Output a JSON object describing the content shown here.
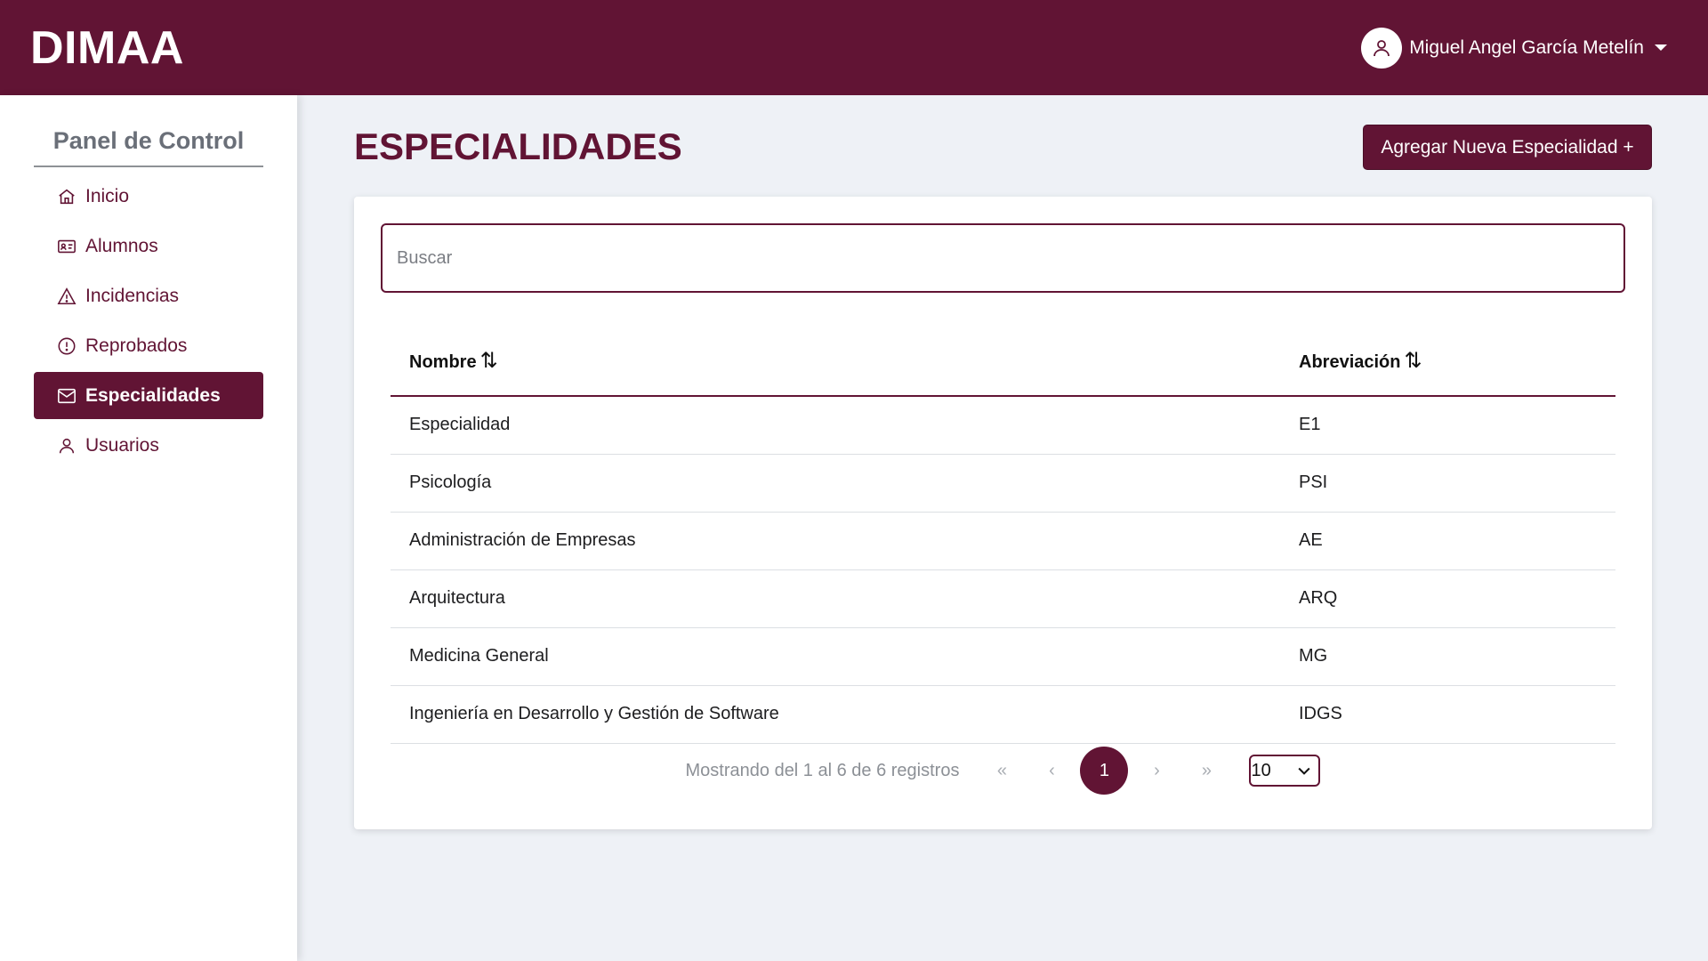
{
  "header": {
    "brand": "DIMAA",
    "user_name": "Miguel Angel García Metelín",
    "color": "#611434"
  },
  "sidebar": {
    "title": "Panel de Control",
    "items": [
      {
        "label": "Inicio",
        "icon": "home-icon",
        "active": false
      },
      {
        "label": "Alumnos",
        "icon": "id-card-icon",
        "active": false
      },
      {
        "label": "Incidencias",
        "icon": "warning-icon",
        "active": false
      },
      {
        "label": "Reprobados",
        "icon": "alert-circle-icon",
        "active": false
      },
      {
        "label": "Especialidades",
        "icon": "envelope-icon",
        "active": true
      },
      {
        "label": "Usuarios",
        "icon": "user-icon",
        "active": false
      }
    ]
  },
  "main": {
    "title": "ESPECIALIDADES",
    "add_button": "Agregar Nueva Especialidad +",
    "search_placeholder": "Buscar",
    "columns": [
      "Nombre",
      "Abreviación"
    ],
    "sort_icon": "⇅",
    "rows": [
      {
        "nombre": "Especialidad",
        "abreviacion": "E1"
      },
      {
        "nombre": "Psicología",
        "abreviacion": "PSI"
      },
      {
        "nombre": "Administración de Empresas",
        "abreviacion": "AE"
      },
      {
        "nombre": "Arquitectura",
        "abreviacion": "ARQ"
      },
      {
        "nombre": "Medicina General",
        "abreviacion": "MG"
      },
      {
        "nombre": "Ingeniería en Desarrollo y Gestión de Software",
        "abreviacion": "IDGS"
      }
    ],
    "pagination": {
      "info": "Mostrando del 1 al 6 de 6 registros",
      "first": "«",
      "prev": "‹",
      "current_page": "1",
      "next": "›",
      "last": "»",
      "page_size": "10"
    }
  }
}
